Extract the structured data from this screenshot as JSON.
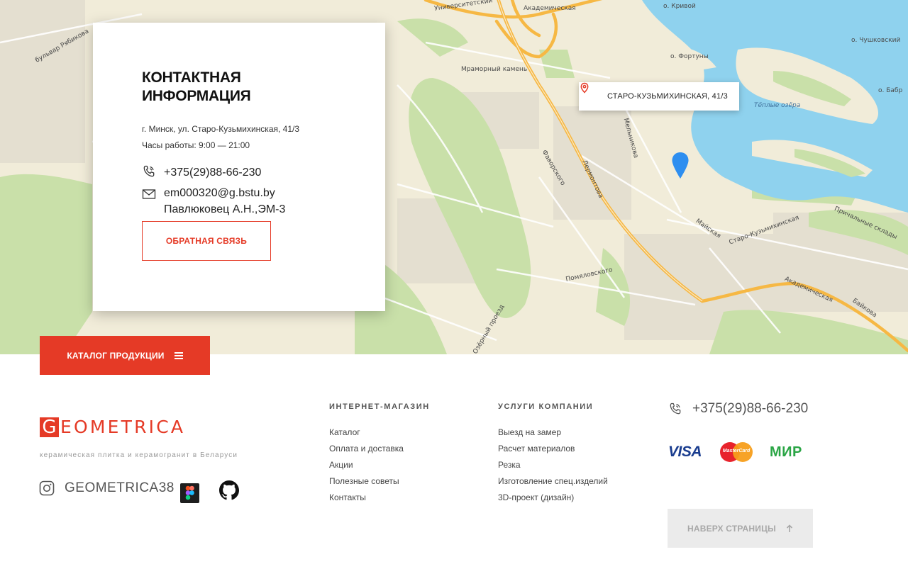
{
  "map": {
    "address_pin_label": "СТАРО-КУЗЬМИХИНСКАЯ, 41/3",
    "labels": {
      "island_krivoy": "о. Кривой",
      "island_chushkovsky": "о. Чушковский",
      "island_fortuny": "о. Фортуны",
      "island_babr": "о. Бабр",
      "lake_teploe": "Тёплые озёра",
      "akademicheskaya_top": "Академическая",
      "universitetsky": "Университетский",
      "marble_stone": "Мраморный камень",
      "bulvar_ryabikova": "бульвар Рябикова",
      "favorsky": "Фаворского",
      "lermontova": "Лермонтова",
      "melnikova": "Мельникова",
      "maiskaya": "Майская",
      "staro_kuzmikhinskaya": "Старо-Кузьмихинская",
      "pomyalovskogo": "Помяловского",
      "akademicheskaya_bottom": "Академическая",
      "baykalskaya": "Байкова",
      "prichal_sklady": "Причальные склады",
      "ozerny_proezd": "Озёрный проезд"
    }
  },
  "contact": {
    "title": "КОНТАКТНАЯ ИНФОРМАЦИЯ",
    "address": "г. Минск, ул. Старо-Кузьмихинская, 41/3",
    "hours": "Часы работы: 9:00 — 21:00",
    "phone": "+375(29)88-66-230",
    "email": "em000320@g.bstu.by",
    "person": "Павлюковец А.Н.,ЭМ-3",
    "feedback_button": "ОБРАТНАЯ СВЯЗЬ"
  },
  "catalog_button": "КАТАЛОГ ПРОДУКЦИИ",
  "footer": {
    "logo_letter": "G",
    "logo_rest": "EOMETRICA",
    "tagline": "керамическая плитка и керамогранит в Беларуси",
    "social_handle": "GEOMETRICA38",
    "shop": {
      "heading": "ИНТЕРНЕТ-МАГАЗИН",
      "links": [
        "Каталог",
        "Оплата и доставка",
        "Акции",
        "Полезные советы",
        "Контакты"
      ]
    },
    "services": {
      "heading": "УСЛУГИ КОМПАНИИ",
      "links": [
        "Выезд на замер",
        "Расчет материалов",
        "Резка",
        "Изготовление спец.изделий",
        "3D-проект (дизайн)"
      ]
    },
    "phone": "+375(29)88-66-230",
    "payments": {
      "visa": "VISA",
      "mastercard": "MasterCard",
      "mir": "МИР"
    },
    "top_button": "НАВЕРХ СТРАНИЦЫ"
  },
  "colors": {
    "accent": "#e53a26",
    "water": "#8fd2ee",
    "park": "#c6dea6",
    "road": "#f6b844",
    "land": "#f1ecd9"
  },
  "icons": [
    "location-pin-icon",
    "map-marker-icon",
    "phone-icon",
    "mail-icon",
    "menu-icon",
    "instagram-icon",
    "figma-icon",
    "github-icon",
    "arrow-up-icon"
  ]
}
